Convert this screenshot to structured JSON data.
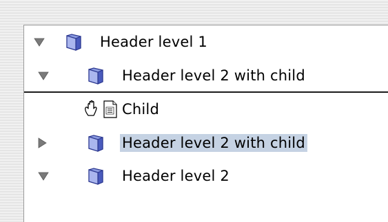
{
  "tree": {
    "rows": [
      {
        "label": "Header level 1",
        "expanded": true,
        "icon": "folder-icon"
      },
      {
        "label": "Header level 2 with child",
        "expanded": true,
        "icon": "folder-icon"
      },
      {
        "label": "Child",
        "icon": "document-icon",
        "cursor": "open-hand-cursor-icon"
      },
      {
        "label": "Header level 2 with child",
        "expanded": false,
        "selected": true,
        "icon": "folder-icon"
      },
      {
        "label": "Header level 2",
        "expanded": true,
        "icon": "folder-icon"
      }
    ]
  },
  "colors": {
    "selection": "#c5d2e3",
    "folder_blue": "#5d6fc7",
    "disclosure_gray": "#7a7a7a"
  }
}
